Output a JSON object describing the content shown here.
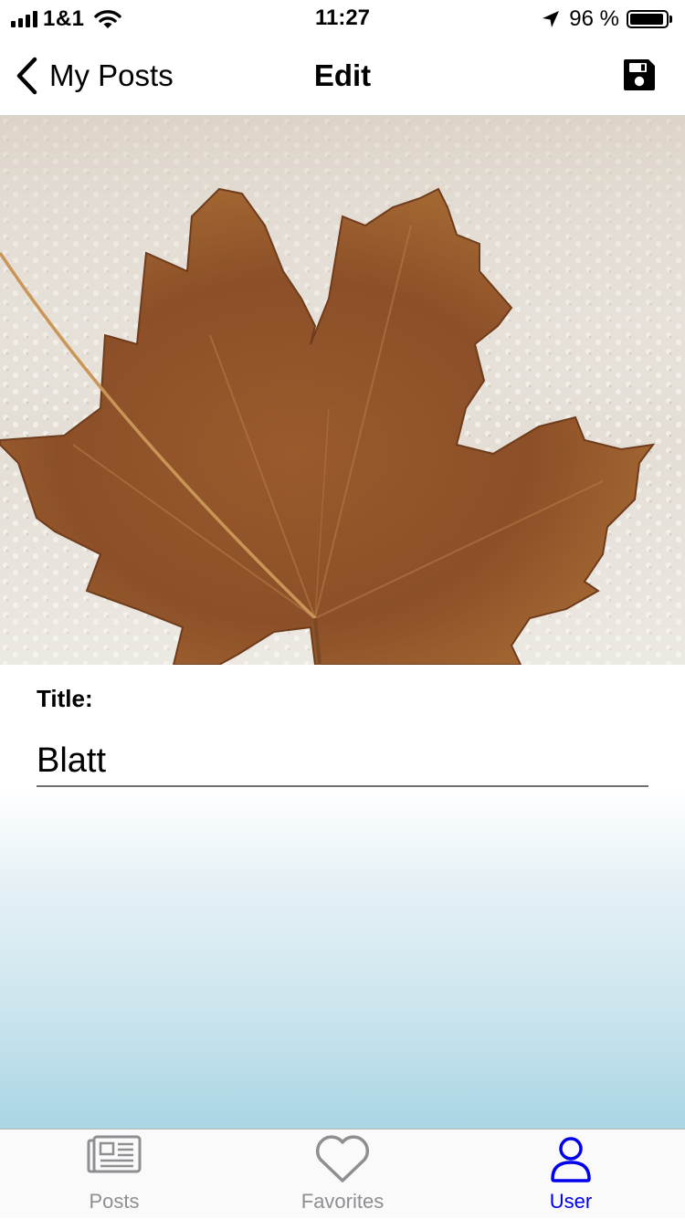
{
  "status_bar": {
    "carrier": "1&1",
    "time": "11:27",
    "battery_percent": "96 %",
    "battery_level": 0.96,
    "icons": [
      "signal-icon",
      "wifi-icon",
      "location-arrow-icon",
      "battery-icon"
    ]
  },
  "nav": {
    "back_label": "My Posts",
    "title": "Edit",
    "back_icon": "chevron-left-icon",
    "save_icon": "floppy-disk-icon"
  },
  "image": {
    "subject": "leaf",
    "description": "Dried brown maple leaf on white textured paper towel"
  },
  "form": {
    "title_label": "Title:",
    "title_value": "Blatt"
  },
  "tabs": [
    {
      "label": "Posts",
      "icon": "newspaper-icon",
      "active": false
    },
    {
      "label": "Favorites",
      "icon": "heart-icon",
      "active": false
    },
    {
      "label": "User",
      "icon": "user-icon",
      "active": true
    }
  ],
  "colors": {
    "accent": "#0000ee",
    "inactive_tab": "#8e8e93",
    "gradient_bottom": "#a9d5e4"
  }
}
